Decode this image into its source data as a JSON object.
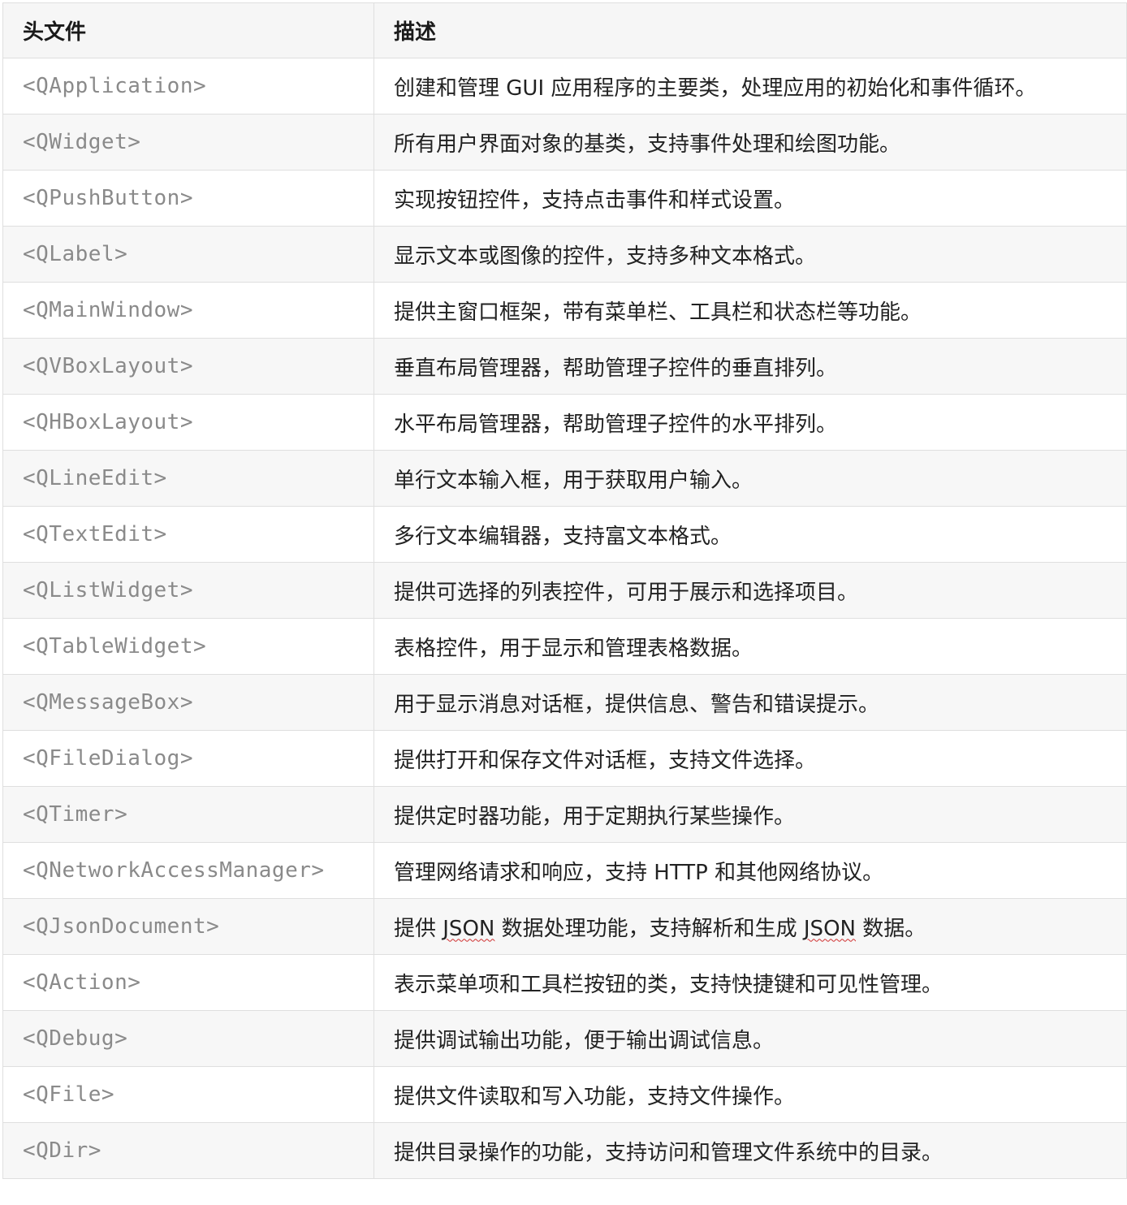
{
  "table": {
    "headers": [
      "头文件",
      "描述"
    ],
    "rows": [
      {
        "header": "<QApplication>",
        "description": "创建和管理 GUI 应用程序的主要类，处理应用的初始化和事件循环。"
      },
      {
        "header": "<QWidget>",
        "description": "所有用户界面对象的基类，支持事件处理和绘图功能。"
      },
      {
        "header": "<QPushButton>",
        "description": "实现按钮控件，支持点击事件和样式设置。"
      },
      {
        "header": "<QLabel>",
        "description": "显示文本或图像的控件，支持多种文本格式。"
      },
      {
        "header": "<QMainWindow>",
        "description": "提供主窗口框架，带有菜单栏、工具栏和状态栏等功能。"
      },
      {
        "header": "<QVBoxLayout>",
        "description": "垂直布局管理器，帮助管理子控件的垂直排列。"
      },
      {
        "header": "<QHBoxLayout>",
        "description": "水平布局管理器，帮助管理子控件的水平排列。"
      },
      {
        "header": "<QLineEdit>",
        "description": "单行文本输入框，用于获取用户输入。"
      },
      {
        "header": "<QTextEdit>",
        "description": "多行文本编辑器，支持富文本格式。"
      },
      {
        "header": "<QListWidget>",
        "description": "提供可选择的列表控件，可用于展示和选择项目。"
      },
      {
        "header": "<QTableWidget>",
        "description": "表格控件，用于显示和管理表格数据。"
      },
      {
        "header": "<QMessageBox>",
        "description": "用于显示消息对话框，提供信息、警告和错误提示。"
      },
      {
        "header": "<QFileDialog>",
        "description": "提供打开和保存文件对话框，支持文件选择。"
      },
      {
        "header": "<QTimer>",
        "description": "提供定时器功能，用于定期执行某些操作。"
      },
      {
        "header": "<QNetworkAccessManager>",
        "description": "管理网络请求和响应，支持 HTTP 和其他网络协议。"
      },
      {
        "header": "<QJsonDocument>",
        "description": "提供 JSON 数据处理功能，支持解析和生成 JSON 数据。"
      },
      {
        "header": "<QAction>",
        "description": "表示菜单项和工具栏按钮的类，支持快捷键和可见性管理。"
      },
      {
        "header": "<QDebug>",
        "description": "提供调试输出功能，便于输出调试信息。"
      },
      {
        "header": "<QFile>",
        "description": "提供文件读取和写入功能，支持文件操作。"
      },
      {
        "header": "<QDir>",
        "description": "提供目录操作的功能，支持访问和管理文件系统中的目录。"
      }
    ]
  }
}
